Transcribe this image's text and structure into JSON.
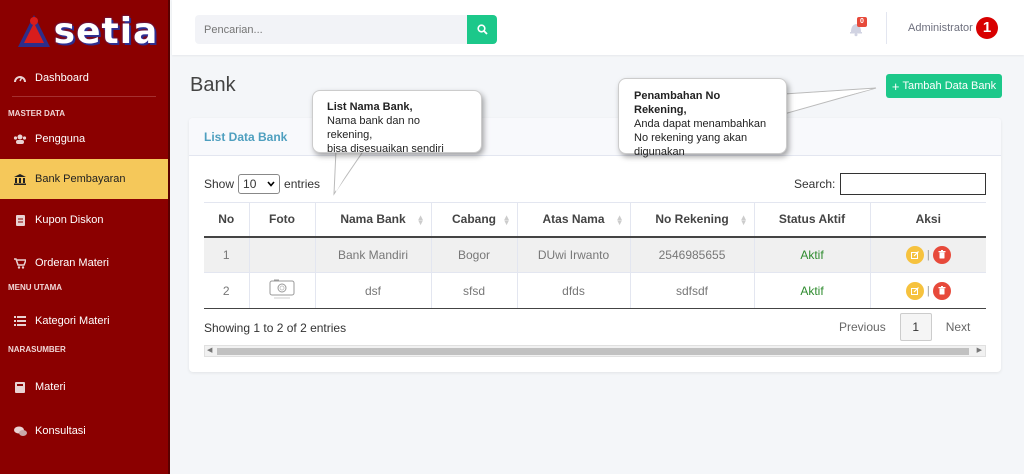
{
  "brand": {
    "name": "setia"
  },
  "sidebar": {
    "items": [
      {
        "key": "dashboard",
        "label": "Dashboard",
        "icon": "tachometer-icon"
      },
      {
        "key": "master_head",
        "label": "MASTER DATA"
      },
      {
        "key": "pengguna",
        "label": "Pengguna",
        "icon": "users-icon"
      },
      {
        "key": "bank",
        "label": "Bank Pembayaran",
        "icon": "bank-icon",
        "active": true
      },
      {
        "key": "kupon",
        "label": "Kupon Diskon",
        "icon": "file-icon"
      },
      {
        "key": "orderan",
        "label": "Orderan Materi",
        "icon": "cart-icon"
      },
      {
        "key": "menu_head",
        "label": "MENU UTAMA"
      },
      {
        "key": "kategori",
        "label": "Kategori Materi",
        "icon": "list-icon"
      },
      {
        "key": "nara_head",
        "label": "NARASUMBER"
      },
      {
        "key": "materi",
        "label": "Materi",
        "icon": "book-icon"
      },
      {
        "key": "konsultasi",
        "label": "Konsultasi",
        "icon": "comments-icon"
      }
    ]
  },
  "topbar": {
    "search_placeholder": "Pencarian...",
    "notification_count": "0",
    "user_name": "Administrator",
    "avatar_text": "1"
  },
  "page": {
    "title": "Bank",
    "add_button": "Tambah Data Bank"
  },
  "card": {
    "title": "List Data Bank",
    "show_label": "Show",
    "entries_value": "10",
    "entries_label": "entries",
    "search_label": "Search:",
    "columns": [
      "No",
      "Foto",
      "Nama Bank",
      "Cabang",
      "Atas Nama",
      "No Rekening",
      "Status Aktif",
      "Aksi"
    ],
    "rows": [
      {
        "no": "1",
        "foto": "",
        "nama_bank": "Bank Mandiri",
        "cabang": "Bogor",
        "atas_nama": "DUwi Irwanto",
        "no_rekening": "2546985655",
        "status": "Aktif"
      },
      {
        "no": "2",
        "foto": "image-placeholder",
        "nama_bank": "dsf",
        "cabang": "sfsd",
        "atas_nama": "dfds",
        "no_rekening": "sdfsdf",
        "status": "Aktif"
      }
    ],
    "info": "Showing 1 to 2 of 2 entries",
    "pagination": {
      "previous": "Previous",
      "current": "1",
      "next": "Next"
    }
  },
  "callouts": {
    "list": {
      "title": "List Nama Bank,",
      "lines": [
        "Nama bank dan no rekening,",
        "bisa disesuaikan sendiri"
      ]
    },
    "add": {
      "title": "Penambahan No Rekening,",
      "lines": [
        "Anda dapat menambahkan",
        "No rekening yang akan",
        "digunakan"
      ]
    }
  },
  "colors": {
    "sidebar": "#8b0000",
    "active": "#f5c85a",
    "accent": "#1cc88a",
    "header_text": "#4e9fbf",
    "status": "#2e8b2e"
  }
}
